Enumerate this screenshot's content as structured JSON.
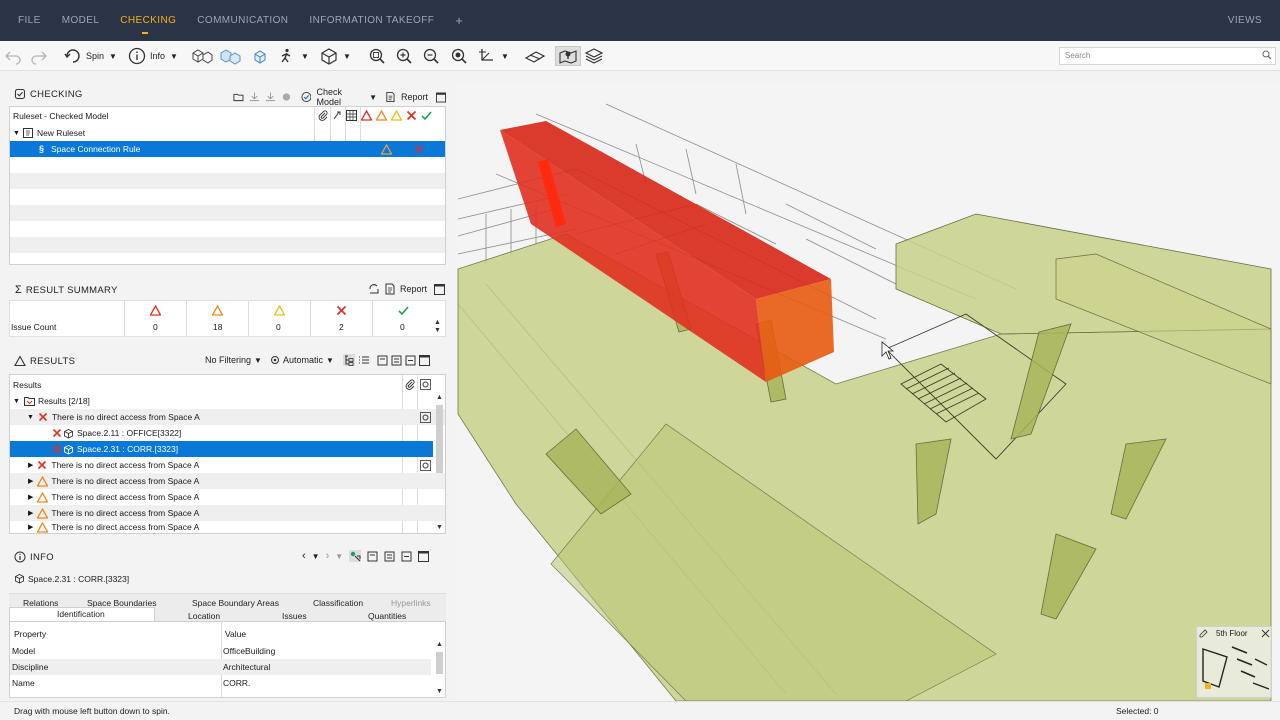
{
  "menu": {
    "items": [
      "FILE",
      "MODEL",
      "CHECKING",
      "COMMUNICATION",
      "INFORMATION TAKEOFF"
    ],
    "add": "+",
    "views": "VIEWS"
  },
  "toolbar": {
    "spin": "Spin",
    "info": "Info",
    "search_placeholder": "Search"
  },
  "checking": {
    "title": "CHECKING",
    "check_model": "Check Model",
    "report": "Report",
    "ruleset_row": "Ruleset - Checked Model",
    "new_ruleset": "New Ruleset",
    "rule": "Space Connection Rule"
  },
  "summary": {
    "title": "RESULT SUMMARY",
    "report": "Report",
    "row_label": "Issue Count",
    "counts": [
      "0",
      "18",
      "0",
      "2",
      "0"
    ]
  },
  "results": {
    "title": "RESULTS",
    "filter": "No Filtering",
    "mode": "Automatic",
    "col": "Results",
    "root": "Results [2/18]",
    "issue_text": "There is no direct access from Space A",
    "child1": "Space.2.11 : OFFICE[3322]",
    "child2": "Space.2.31 : CORR.[3323]"
  },
  "info": {
    "title": "INFO",
    "object": "Space.2.31 : CORR.[3323]",
    "tabs_top": [
      "Relations",
      "Space Boundaries",
      "Space Boundary Areas",
      "Classification",
      "Hyperlinks"
    ],
    "tabs_bottom": [
      "Identification",
      "Location",
      "Issues",
      "Quantities"
    ],
    "col_property": "Property",
    "col_value": "Value",
    "props": [
      {
        "k": "Model",
        "v": "OfficeBuilding"
      },
      {
        "k": "Discipline",
        "v": "Architectural"
      },
      {
        "k": "Name",
        "v": "CORR."
      }
    ]
  },
  "viewport": {
    "label": "3D",
    "floor_label": "5th Floor"
  },
  "status": {
    "hint": "Drag with mouse left button down to spin.",
    "selected": "Selected: 0"
  },
  "colors": {
    "accent": "#f1b21b",
    "selection": "#0a78d7",
    "topbar": "#2b3446",
    "space_fill": "#c3cd80",
    "error_red": "#e03020"
  }
}
